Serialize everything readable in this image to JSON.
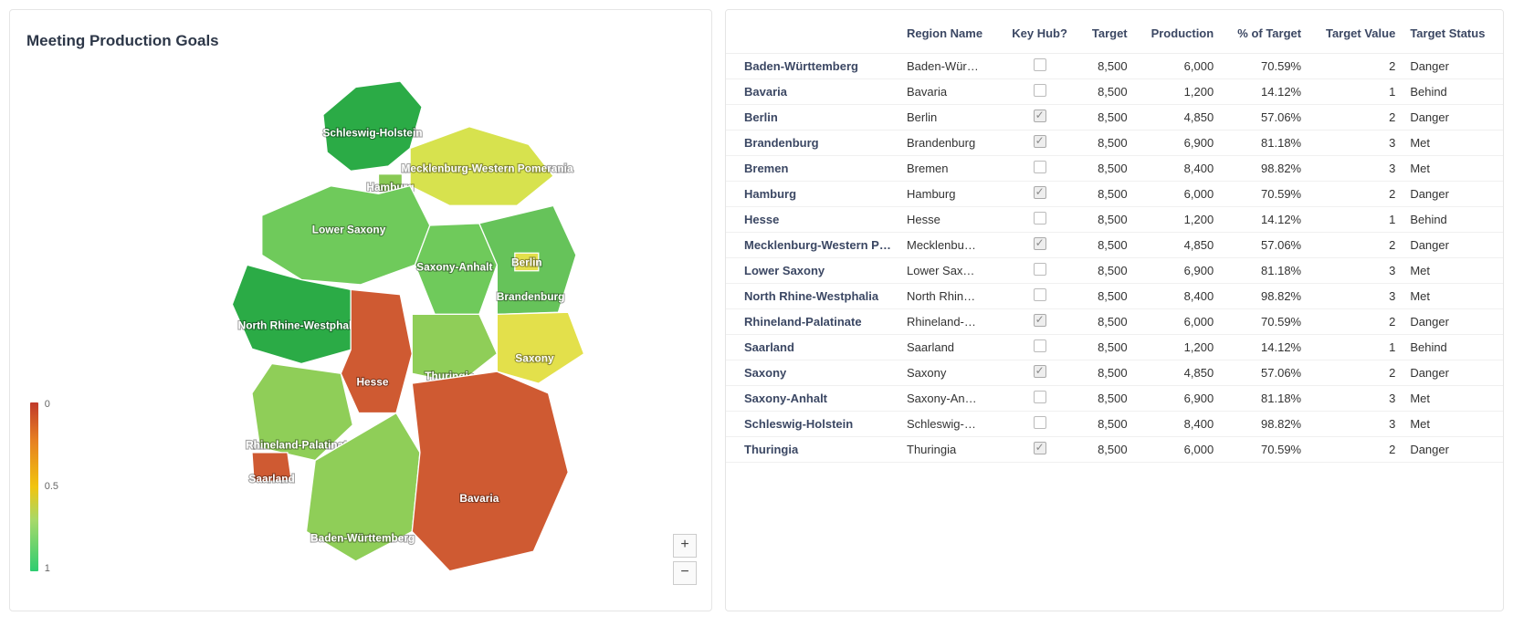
{
  "map": {
    "title": "Meeting Production Goals",
    "legend": {
      "top": "0",
      "mid": "0.5",
      "bottom": "1"
    },
    "zoom_in": "+",
    "zoom_out": "−",
    "states": [
      {
        "id": "schleswig-holstein",
        "label": "Schleswig-Holstein"
      },
      {
        "id": "mecklenburg",
        "label": "Mecklenburg-Western Pomerania"
      },
      {
        "id": "hamburg",
        "label": "Hamburg"
      },
      {
        "id": "lower-saxony",
        "label": "Lower Saxony"
      },
      {
        "id": "saxony-anhalt",
        "label": "Saxony-Anhalt"
      },
      {
        "id": "berlin",
        "label": "Berlin"
      },
      {
        "id": "brandenburg",
        "label": "Brandenburg"
      },
      {
        "id": "nrw",
        "label": "North Rhine-Westphalia"
      },
      {
        "id": "hesse",
        "label": "Hesse"
      },
      {
        "id": "thuringia",
        "label": "Thuringia"
      },
      {
        "id": "saxony",
        "label": "Saxony"
      },
      {
        "id": "rhineland",
        "label": "Rhineland-Palatinate"
      },
      {
        "id": "saarland",
        "label": "Saarland"
      },
      {
        "id": "bw",
        "label": "Baden-Württemberg"
      },
      {
        "id": "bavaria",
        "label": "Bavaria"
      }
    ]
  },
  "table": {
    "columns": [
      "",
      "Region Name",
      "Key Hub?",
      "Target",
      "Production",
      "% of Target",
      "Target Value",
      "Target Status"
    ],
    "rows": [
      {
        "name": "Baden-Württemberg",
        "region": "Baden-Wür…",
        "key_hub": false,
        "target": "8,500",
        "production": "6,000",
        "pct": "70.59%",
        "tval": "2",
        "status": "Danger"
      },
      {
        "name": "Bavaria",
        "region": "Bavaria",
        "key_hub": false,
        "target": "8,500",
        "production": "1,200",
        "pct": "14.12%",
        "tval": "1",
        "status": "Behind"
      },
      {
        "name": "Berlin",
        "region": "Berlin",
        "key_hub": true,
        "target": "8,500",
        "production": "4,850",
        "pct": "57.06%",
        "tval": "2",
        "status": "Danger"
      },
      {
        "name": "Brandenburg",
        "region": "Brandenburg",
        "key_hub": true,
        "target": "8,500",
        "production": "6,900",
        "pct": "81.18%",
        "tval": "3",
        "status": "Met"
      },
      {
        "name": "Bremen",
        "region": "Bremen",
        "key_hub": false,
        "target": "8,500",
        "production": "8,400",
        "pct": "98.82%",
        "tval": "3",
        "status": "Met"
      },
      {
        "name": "Hamburg",
        "region": "Hamburg",
        "key_hub": true,
        "target": "8,500",
        "production": "6,000",
        "pct": "70.59%",
        "tval": "2",
        "status": "Danger"
      },
      {
        "name": "Hesse",
        "region": "Hesse",
        "key_hub": false,
        "target": "8,500",
        "production": "1,200",
        "pct": "14.12%",
        "tval": "1",
        "status": "Behind"
      },
      {
        "name": "Mecklenburg-Western Po…",
        "region": "Mecklenbu…",
        "key_hub": true,
        "target": "8,500",
        "production": "4,850",
        "pct": "57.06%",
        "tval": "2",
        "status": "Danger"
      },
      {
        "name": "Lower Saxony",
        "region": "Lower Sax…",
        "key_hub": false,
        "target": "8,500",
        "production": "6,900",
        "pct": "81.18%",
        "tval": "3",
        "status": "Met"
      },
      {
        "name": "North Rhine-Westphalia",
        "region": "North Rhin…",
        "key_hub": false,
        "target": "8,500",
        "production": "8,400",
        "pct": "98.82%",
        "tval": "3",
        "status": "Met"
      },
      {
        "name": "Rhineland-Palatinate",
        "region": "Rhineland-…",
        "key_hub": true,
        "target": "8,500",
        "production": "6,000",
        "pct": "70.59%",
        "tval": "2",
        "status": "Danger"
      },
      {
        "name": "Saarland",
        "region": "Saarland",
        "key_hub": false,
        "target": "8,500",
        "production": "1,200",
        "pct": "14.12%",
        "tval": "1",
        "status": "Behind"
      },
      {
        "name": "Saxony",
        "region": "Saxony",
        "key_hub": true,
        "target": "8,500",
        "production": "4,850",
        "pct": "57.06%",
        "tval": "2",
        "status": "Danger"
      },
      {
        "name": "Saxony-Anhalt",
        "region": "Saxony-An…",
        "key_hub": false,
        "target": "8,500",
        "production": "6,900",
        "pct": "81.18%",
        "tval": "3",
        "status": "Met"
      },
      {
        "name": "Schleswig-Holstein",
        "region": "Schleswig-…",
        "key_hub": false,
        "target": "8,500",
        "production": "8,400",
        "pct": "98.82%",
        "tval": "3",
        "status": "Met"
      },
      {
        "name": "Thuringia",
        "region": "Thuringia",
        "key_hub": true,
        "target": "8,500",
        "production": "6,000",
        "pct": "70.59%",
        "tval": "2",
        "status": "Danger"
      }
    ]
  },
  "chart_data": {
    "type": "heatmap",
    "title": "Meeting Production Goals",
    "value_label": "% of Target (fraction)",
    "scale": {
      "min": 0,
      "max": 1,
      "colormap": "red-yellow-green"
    },
    "regions": [
      {
        "name": "Baden-Württemberg",
        "value": 0.7059
      },
      {
        "name": "Bavaria",
        "value": 0.1412
      },
      {
        "name": "Berlin",
        "value": 0.5706
      },
      {
        "name": "Brandenburg",
        "value": 0.8118
      },
      {
        "name": "Bremen",
        "value": 0.9882
      },
      {
        "name": "Hamburg",
        "value": 0.7059
      },
      {
        "name": "Hesse",
        "value": 0.1412
      },
      {
        "name": "Mecklenburg-Western Pomerania",
        "value": 0.5706
      },
      {
        "name": "Lower Saxony",
        "value": 0.8118
      },
      {
        "name": "North Rhine-Westphalia",
        "value": 0.9882
      },
      {
        "name": "Rhineland-Palatinate",
        "value": 0.7059
      },
      {
        "name": "Saarland",
        "value": 0.1412
      },
      {
        "name": "Saxony",
        "value": 0.5706
      },
      {
        "name": "Saxony-Anhalt",
        "value": 0.8118
      },
      {
        "name": "Schleswig-Holstein",
        "value": 0.9882
      },
      {
        "name": "Thuringia",
        "value": 0.7059
      }
    ]
  }
}
